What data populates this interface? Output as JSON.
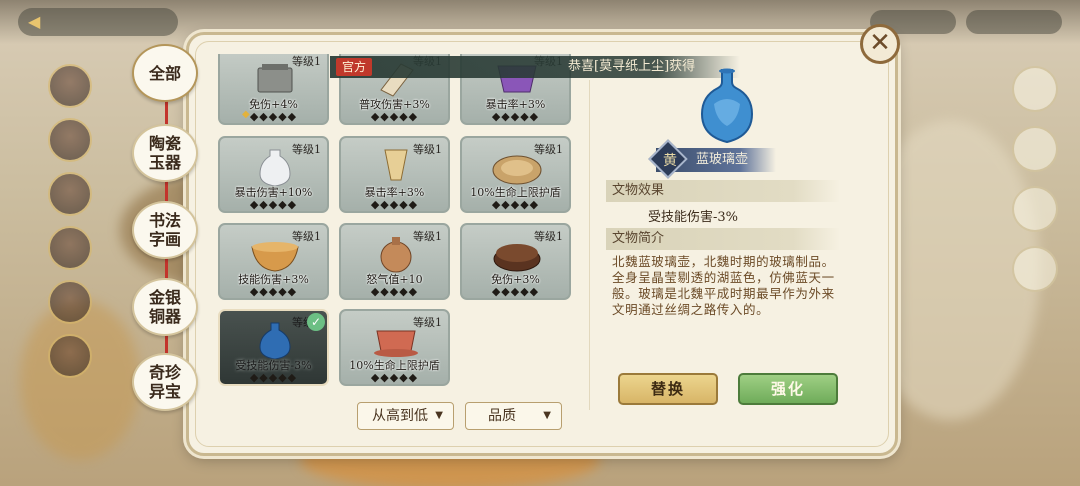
{
  "background": {
    "top_left_button": "",
    "resources": [
      "",
      ""
    ]
  },
  "announcement": {
    "tag": "官方",
    "message": "恭喜[莫寻纸上尘]获得"
  },
  "categories": [
    {
      "label": "全部",
      "active": true
    },
    {
      "label": "陶瓷玉器",
      "active": false
    },
    {
      "label": "书法字画",
      "active": false
    },
    {
      "label": "金银铜器",
      "active": false
    },
    {
      "label": "奇珍异宝",
      "active": false
    }
  ],
  "artifacts": [
    {
      "level": "等级1",
      "effect": "免伤+4%",
      "stars": "◆◆◆◆◆",
      "item": "box-icon",
      "gold_mark": true
    },
    {
      "level": "等级1",
      "effect": "普攻伤害+3%",
      "stars": "◆◆◆◆◆",
      "item": "scroll-icon",
      "gold_mark": false
    },
    {
      "level": "等级1",
      "effect": "暴击率+3%",
      "stars": "◆◆◆◆◆",
      "item": "purple-bowl-icon",
      "gold_mark": false
    },
    {
      "level": "等级1",
      "effect": "暴击伤害+10%",
      "stars": "◆◆◆◆◆",
      "item": "white-vase-icon",
      "gold_mark": false
    },
    {
      "level": "等级1",
      "effect": "暴击率+3%",
      "stars": "◆◆◆◆◆",
      "item": "horn-cup-icon",
      "gold_mark": false
    },
    {
      "level": "等级1",
      "effect": "10%生命上限护盾",
      "stars": "◆◆◆◆◆",
      "item": "gold-plate-icon",
      "gold_mark": false
    },
    {
      "level": "等级1",
      "effect": "技能伤害+3%",
      "stars": "◆◆◆◆◆",
      "item": "gold-bowl-icon",
      "gold_mark": false
    },
    {
      "level": "等级1",
      "effect": "怒气值+10",
      "stars": "◆◆◆◆◆",
      "item": "flask-icon",
      "gold_mark": false
    },
    {
      "level": "等级1",
      "effect": "免伤+3%",
      "stars": "◆◆◆◆◆",
      "item": "lacquer-box-icon",
      "gold_mark": false
    },
    {
      "level": "等级1",
      "effect": "受技能伤害-3%",
      "stars": "◆◆◆◆◆",
      "item": "blue-vase-icon",
      "selected": true,
      "gold_mark": false
    },
    {
      "level": "等级1",
      "effect": "10%生命上限护盾",
      "stars": "◆◆◆◆◆",
      "item": "red-cup-icon",
      "gold_mark": false
    }
  ],
  "sort": {
    "order_label": "从高到低",
    "filter_label": "品质"
  },
  "detail": {
    "grade": "黄",
    "name": "蓝玻璃壶",
    "effect_header": "文物效果",
    "effect_value": "受技能伤害-3%",
    "intro_header": "文物简介",
    "description": "北魏蓝玻璃壶，北魏时期的玻璃制品。全身呈晶莹剔透的湖蓝色，仿佛蓝天一般。玻璃是北魏平成时期最早作为外来文明通过丝绸之路传入的。",
    "replace_label": "替换",
    "enhance_label": "强化"
  },
  "colors": {
    "accent_red": "#c3342c",
    "card_gray": "#b4bdb7",
    "selected_card": "#3a4442",
    "replace_gold": "#e3c57d",
    "enhance_green": "#88c06f"
  }
}
